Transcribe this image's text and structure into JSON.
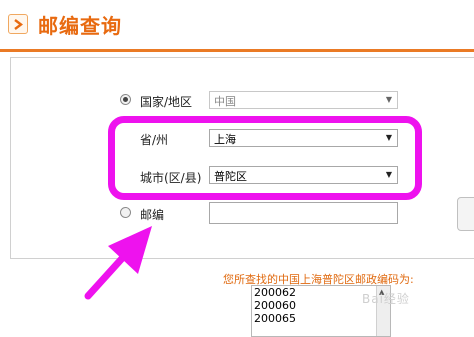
{
  "header": {
    "title": "邮编查询",
    "icon": "chevron-right-icon",
    "accent_color": "#e86a10"
  },
  "form": {
    "country": {
      "label": "国家/地区",
      "value": "中国",
      "selected": true
    },
    "province": {
      "label": "省/州",
      "value": "上海"
    },
    "city": {
      "label": "城市(区/县)",
      "value": "普陀区"
    },
    "postcode": {
      "label": "邮编",
      "value": "",
      "selected": false
    }
  },
  "result": {
    "label": "您所查找的中国上海普陀区邮政编码为:",
    "codes": [
      "200062",
      "200060",
      "200065"
    ]
  },
  "annotation": {
    "highlight_color": "#ee12ee"
  },
  "watermark": "Bai经验"
}
